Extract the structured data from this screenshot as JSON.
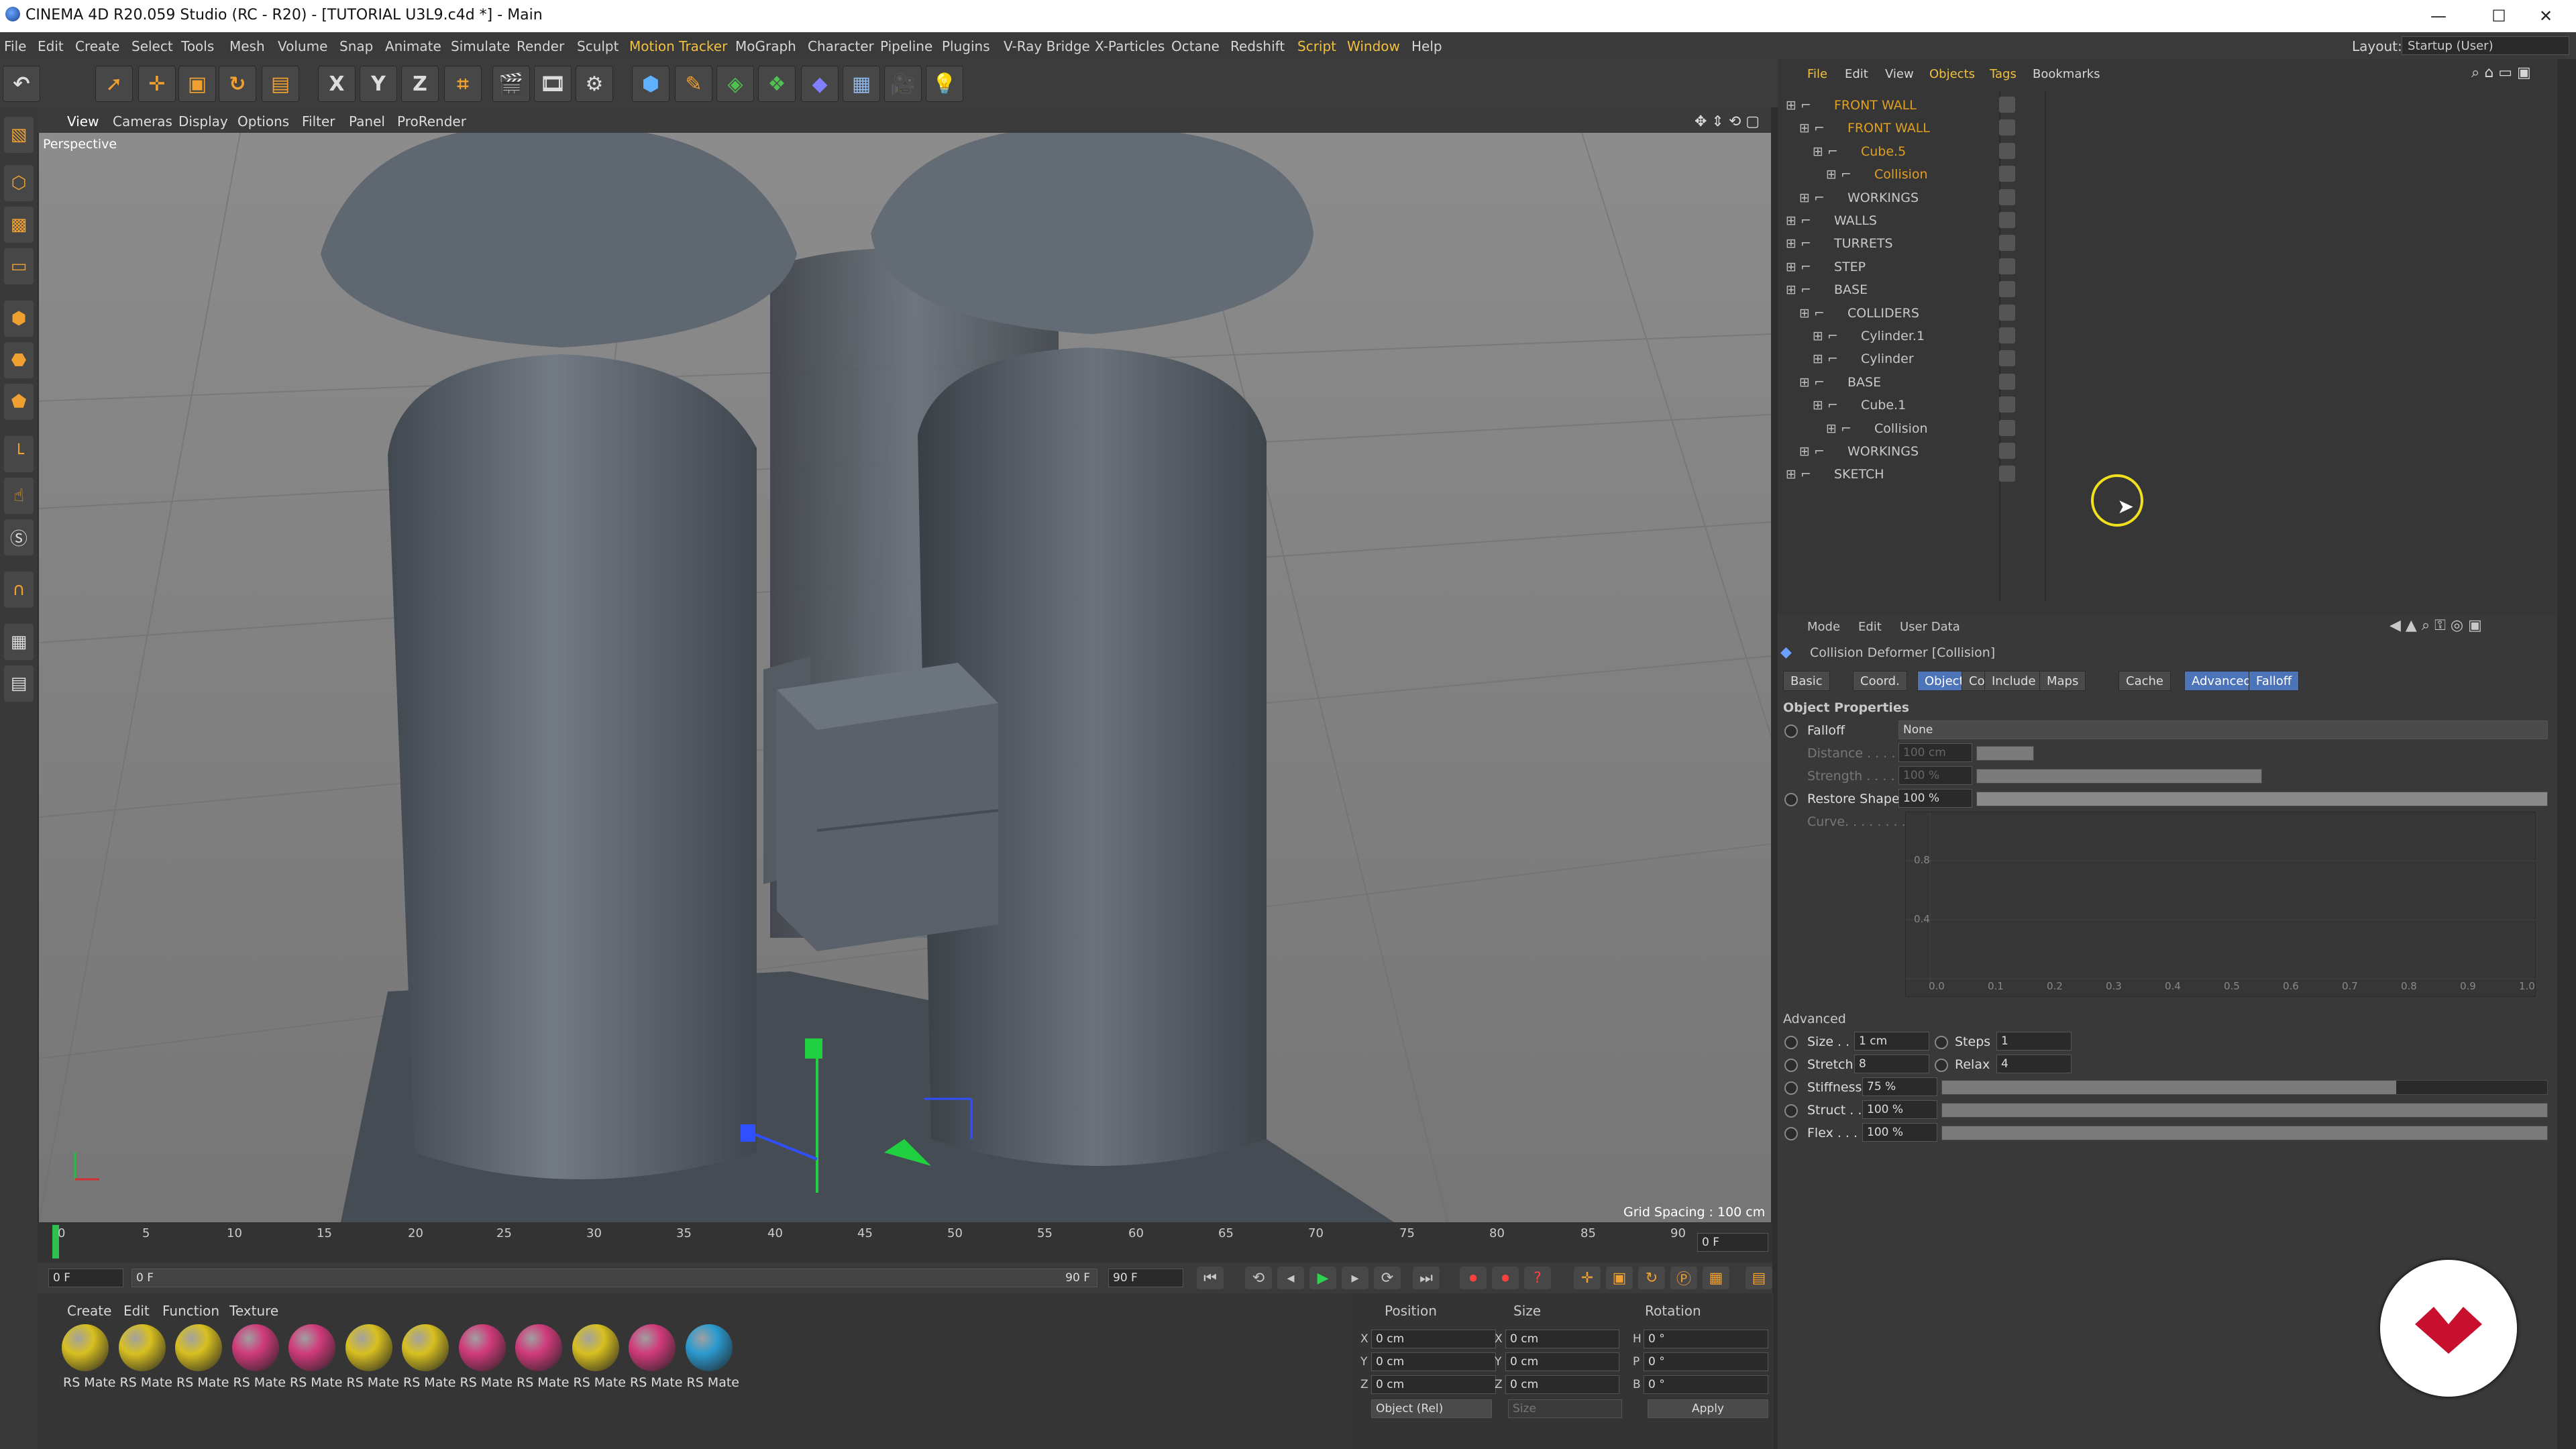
{
  "window": {
    "title": "CINEMA 4D R20.059 Studio (RC - R20) - [TUTORIAL U3L9.c4d *] - Main",
    "minimize": "—",
    "maximize": "☐",
    "close": "✕"
  },
  "menu": [
    "File",
    "Edit",
    "Create",
    "Select",
    "Tools",
    "Mesh",
    "Volume",
    "Snap",
    "Animate",
    "Simulate",
    "Render",
    "Sculpt",
    "Motion Tracker",
    "MoGraph",
    "Character",
    "Pipeline",
    "Plugins",
    "V-Ray Bridge",
    "X-Particles",
    "Octane",
    "Redshift",
    "Script",
    "Window",
    "Help"
  ],
  "layout": {
    "label": "Layout:",
    "value": "Startup (User)"
  },
  "toolbar": {
    "x": "X",
    "y": "Y",
    "z": "Z"
  },
  "viewport": {
    "menu": [
      "View",
      "Cameras",
      "Display",
      "Options",
      "Filter",
      "Panel",
      "ProRender"
    ],
    "label": "Perspective",
    "grid_spacing": "Grid Spacing : 100 cm"
  },
  "timeline": {
    "ticks": [
      "0",
      "5",
      "10",
      "15",
      "20",
      "25",
      "30",
      "35",
      "40",
      "45",
      "50",
      "55",
      "60",
      "65",
      "70",
      "75",
      "80",
      "85",
      "90"
    ],
    "current": "0 F",
    "start": "0 F",
    "end_inner": "90 F",
    "end": "90 F",
    "left_field": "0 F"
  },
  "materials": {
    "menu": [
      "Create",
      "Edit",
      "Function",
      "Texture"
    ],
    "label": "RS Mate",
    "colors": [
      "#d8c020",
      "#d8c020",
      "#d8c020",
      "#d03a7a",
      "#d03a7a",
      "#d8c020",
      "#d8c020",
      "#d03a7a",
      "#d03a7a",
      "#d8c020",
      "#d03a7a",
      "#2a9ad0"
    ]
  },
  "coords": {
    "headers": [
      "Position",
      "Size",
      "Rotation"
    ],
    "rows": [
      {
        "axis": "X",
        "pos": "0 cm",
        "saxis": "X",
        "size": "0 cm",
        "raxis": "H",
        "rot": "0 °"
      },
      {
        "axis": "Y",
        "pos": "0 cm",
        "saxis": "Y",
        "size": "0 cm",
        "raxis": "P",
        "rot": "0 °"
      },
      {
        "axis": "Z",
        "pos": "0 cm",
        "saxis": "Z",
        "size": "0 cm",
        "raxis": "B",
        "rot": "0 °"
      }
    ],
    "mode": "Object (Rel)",
    "size_mode": "Size",
    "apply": "Apply"
  },
  "objmgr": {
    "menu": [
      "File",
      "Edit",
      "View",
      "Objects",
      "Tags",
      "Bookmarks"
    ],
    "rows": [
      {
        "name": "FRONT WALL",
        "color": "#e0a020"
      },
      {
        "name": "FRONT WALL",
        "color": "#e0a020"
      },
      {
        "name": "Cube.5",
        "color": "#e0a020"
      },
      {
        "name": "Collision",
        "color": "#e0a020"
      },
      {
        "name": "WORKINGS",
        "color": "#c8c8c8"
      },
      {
        "name": "WALLS",
        "color": "#c8c8c8"
      },
      {
        "name": "TURRETS",
        "color": "#c8c8c8"
      },
      {
        "name": "STEP",
        "color": "#c8c8c8"
      },
      {
        "name": "BASE",
        "color": "#c8c8c8"
      },
      {
        "name": "COLLIDERS",
        "color": "#c8c8c8"
      },
      {
        "name": "Cylinder.1",
        "color": "#c8c8c8"
      },
      {
        "name": "Cylinder",
        "color": "#c8c8c8"
      },
      {
        "name": "BASE",
        "color": "#c8c8c8"
      },
      {
        "name": "Cube.1",
        "color": "#c8c8c8"
      },
      {
        "name": "Collision",
        "color": "#c8c8c8"
      },
      {
        "name": "WORKINGS",
        "color": "#c8c8c8"
      },
      {
        "name": "SKETCH",
        "color": "#c8c8c8"
      }
    ]
  },
  "attr": {
    "menu": [
      "Mode",
      "Edit",
      "User Data"
    ],
    "title": "Collision Deformer [Collision]",
    "tabs": [
      "Basic",
      "Coord.",
      "Object",
      "Colliders",
      "Include",
      "Maps",
      "Cache",
      "Advanced",
      "Falloff"
    ],
    "section": "Object Properties",
    "falloff_label": "Falloff",
    "falloff_value": "None",
    "distance_label": "Distance . . . .",
    "distance_value": "100 cm",
    "strength_label": "Strength . . . .",
    "strength_value": "100 %",
    "restore_label": "Restore Shape",
    "restore_value": "100 %",
    "curve_label": "Curve. . . . . . . .",
    "curve_y": [
      "0.8",
      "0.4"
    ],
    "curve_x": [
      "0.0",
      "0.1",
      "0.2",
      "0.3",
      "0.4",
      "0.5",
      "0.6",
      "0.7",
      "0.8",
      "0.9",
      "1.0"
    ],
    "advanced": "Advanced",
    "size_label": "Size . . .",
    "size_value": "1 cm",
    "steps_label": "Steps",
    "steps_value": "1",
    "stretch_label": "Stretch",
    "stretch_value": "8",
    "relax_label": "Relax",
    "relax_value": "4",
    "stiffness_label": "Stiffness",
    "stiffness_value": "75 %",
    "stiffness_level": 0.75,
    "struct_label": "Struct . .",
    "struct_value": "100 %",
    "struct_level": 1.0,
    "flex_label": "Flex . . . .",
    "flex_value": "100 %",
    "flex_level": 1.0
  }
}
